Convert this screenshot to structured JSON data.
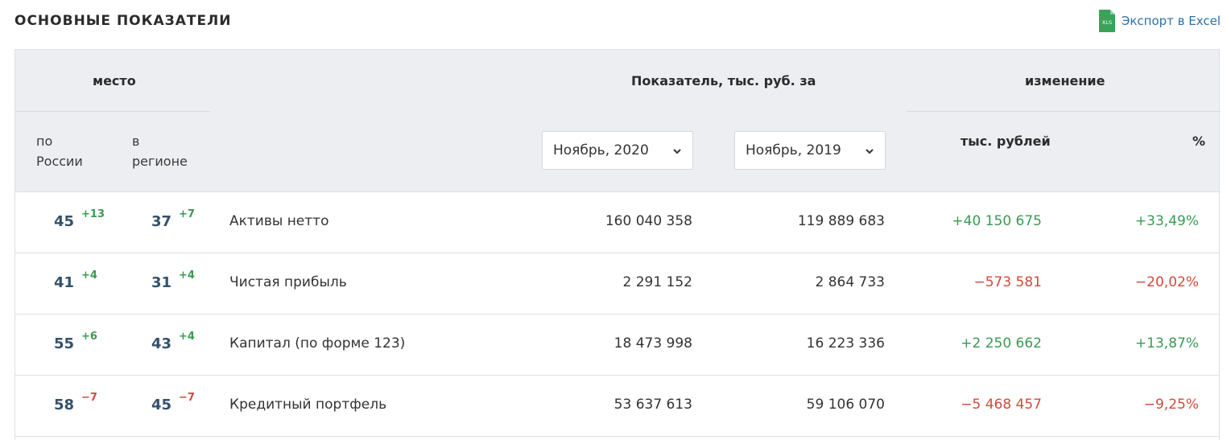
{
  "section_title": "ОСНОВНЫЕ ПОКАЗАТЕЛИ",
  "export": {
    "label": "Экспорт в Excel",
    "icon": "xls-file-icon",
    "icon_text": "XLS"
  },
  "header": {
    "place": "место",
    "place_russia": [
      "по",
      "России"
    ],
    "place_region": [
      "в",
      "регионе"
    ],
    "indicator": "Показатель, тыс. руб. за",
    "change": "изменение",
    "change_rub": "тыс. рублей",
    "change_pct": "%",
    "period1": "Ноябрь, 2020",
    "period2": "Ноябрь, 2019"
  },
  "rows": [
    {
      "rank_russia": "45",
      "delta_russia": "+13",
      "rank_region": "37",
      "delta_region": "+7",
      "name": "Активы нетто",
      "value1": "160 040 358",
      "value2": "119 889 683",
      "change_rub": "+40 150 675",
      "change_pct": "+33,49%"
    },
    {
      "rank_russia": "41",
      "delta_russia": "+4",
      "rank_region": "31",
      "delta_region": "+4",
      "name": "Чистая прибыль",
      "value1": "2 291 152",
      "value2": "2 864 733",
      "change_rub": "−573 581",
      "change_pct": "−20,02%"
    },
    {
      "rank_russia": "55",
      "delta_russia": "+6",
      "rank_region": "43",
      "delta_region": "+4",
      "name": "Капитал (по форме 123)",
      "value1": "18 473 998",
      "value2": "16 223 336",
      "change_rub": "+2 250 662",
      "change_pct": "+13,87%"
    },
    {
      "rank_russia": "58",
      "delta_russia": "−7",
      "rank_region": "45",
      "delta_region": "−7",
      "name": "Кредитный портфель",
      "value1": "53 637 613",
      "value2": "59 106 070",
      "change_rub": "−5 468 457",
      "change_pct": "−9,25%"
    }
  ],
  "colors": {
    "positive": "#3a9a52",
    "negative": "#d14a3c",
    "rank": "#34516b",
    "header_bg": "#eceef1",
    "link": "#2f6fa3"
  }
}
